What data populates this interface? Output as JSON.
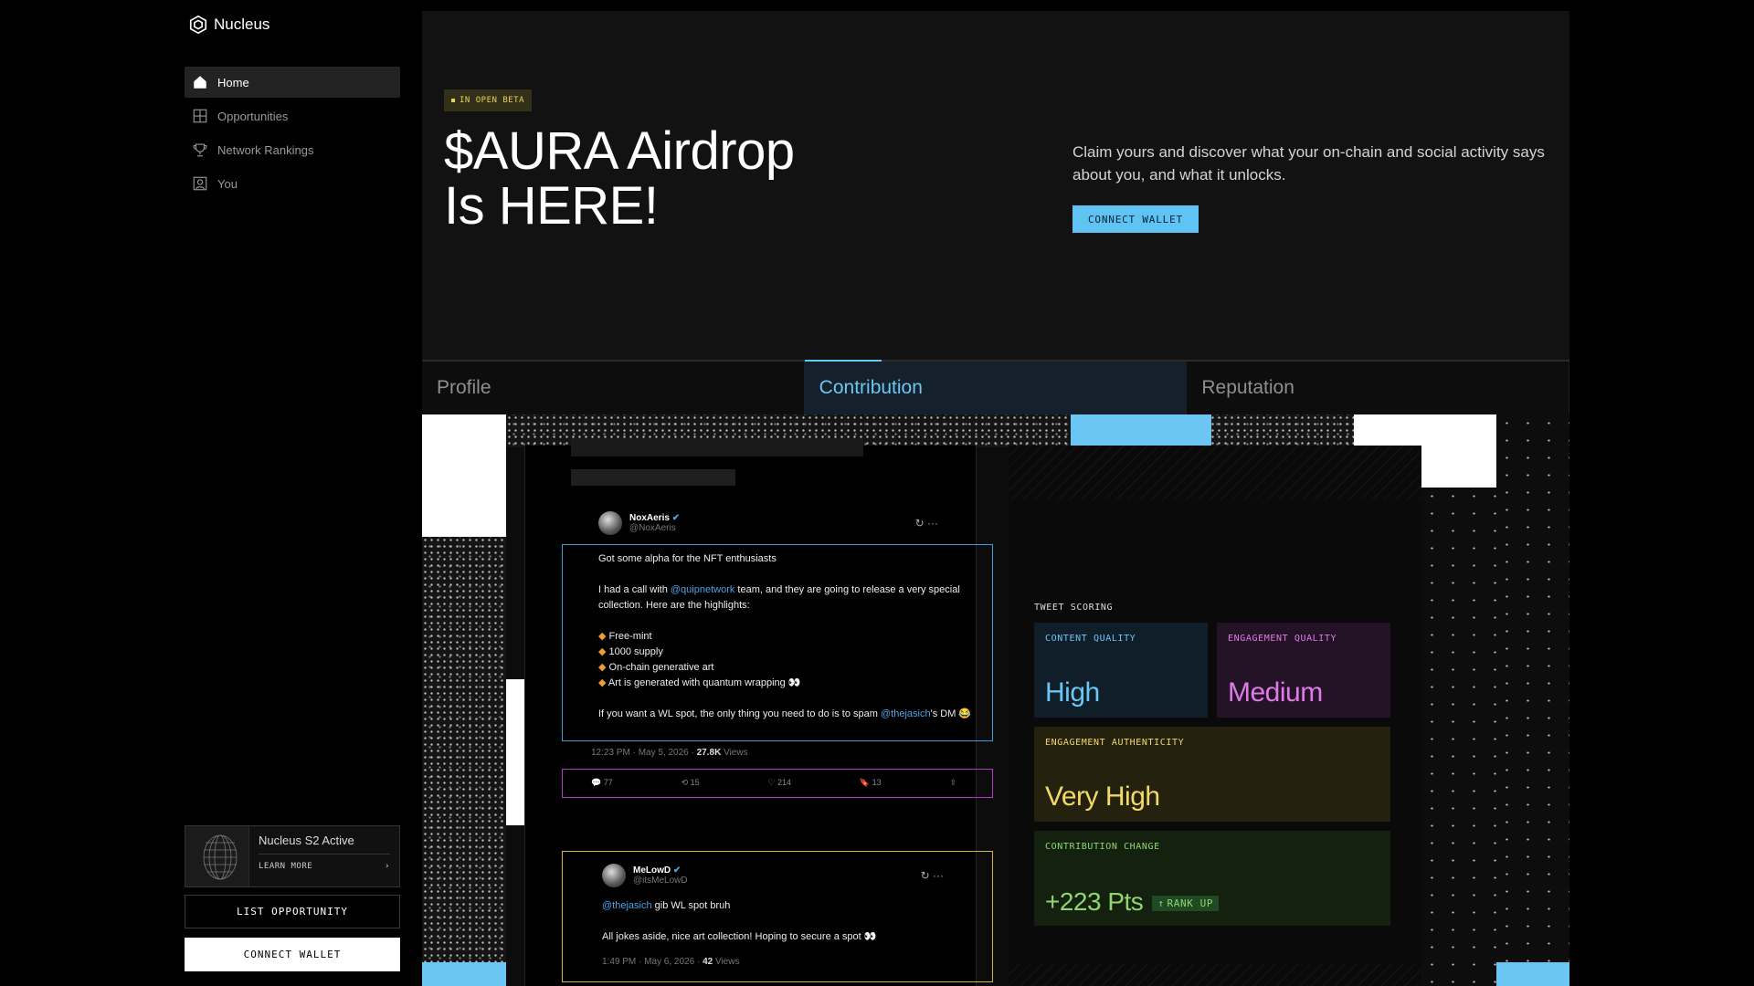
{
  "app": {
    "name": "Nucleus"
  },
  "sidebar": {
    "items": [
      {
        "label": "Home",
        "icon": "home-icon"
      },
      {
        "label": "Opportunities",
        "icon": "grid-icon"
      },
      {
        "label": "Network Rankings",
        "icon": "trophy-icon"
      },
      {
        "label": "You",
        "icon": "user-icon"
      }
    ],
    "promo": {
      "title": "Nucleus S2 Active",
      "link": "LEARN MORE"
    },
    "list_button": "LIST OPPORTUNITY",
    "connect_button": "CONNECT WALLET"
  },
  "hero": {
    "badge": "IN OPEN BETA",
    "title_line1": "$AURA Airdrop",
    "title_line2": "Is HERE!",
    "description": "Claim yours and discover what your on-chain and social activity says about you, and what it unlocks.",
    "button": "CONNECT WALLET"
  },
  "tabs": [
    {
      "label": "Profile",
      "active": false
    },
    {
      "label": "Contribution",
      "active": true
    },
    {
      "label": "Reputation",
      "active": false
    }
  ],
  "tweets": [
    {
      "name": "NoxAeris",
      "handle": "@NoxAeris",
      "line1": "Got some alpha for the NFT enthusiasts",
      "line2_pre": "I had a call with ",
      "line2_link": "@quipnetwork",
      "line2_post": " team, and they are going to release a very special collection. Here are the highlights:",
      "bullets": [
        "Free-mint",
        "1000 supply",
        "On-chain generative art",
        "Art is generated with quantum wrapping 👀"
      ],
      "line3_pre": "If you want a WL spot, the only thing you need to do is to spam ",
      "line3_link": "@thejasich",
      "line3_post": "'s DM 😂",
      "time": "12:23 PM · May 5, 2026 · ",
      "views": "27.8K",
      "views_label": " Views",
      "replies": "77",
      "retweets": "15",
      "likes": "214",
      "bookmarks": "13"
    },
    {
      "name": "MeLowD",
      "handle": "@itsMeLowD",
      "line1_link": "@thejasich",
      "line1_post": " gib WL spot bruh",
      "line2": "All jokes aside, nice art collection! Hoping to secure a spot 👀",
      "time": "1:49 PM · May 6, 2026 · ",
      "views": "42",
      "views_label": " Views"
    }
  ],
  "scoring": {
    "title": "TWEET SCORING",
    "content_quality": {
      "label": "CONTENT QUALITY",
      "value": "High"
    },
    "engagement_quality": {
      "label": "ENGAGEMENT QUALITY",
      "value": "Medium"
    },
    "engagement_authenticity": {
      "label": "ENGAGEMENT AUTHENTICITY",
      "value": "Very High"
    },
    "contribution_change": {
      "label": "CONTRIBUTION CHANGE",
      "value": "+223 Pts",
      "badge": "RANK UP"
    }
  },
  "colors": {
    "accent": "#5fc3f3",
    "beta": "#e8d35a",
    "high": "#6cc6f4",
    "medium": "#e07ae8",
    "very_high": "#f3d86a",
    "pts": "#8fd670"
  }
}
